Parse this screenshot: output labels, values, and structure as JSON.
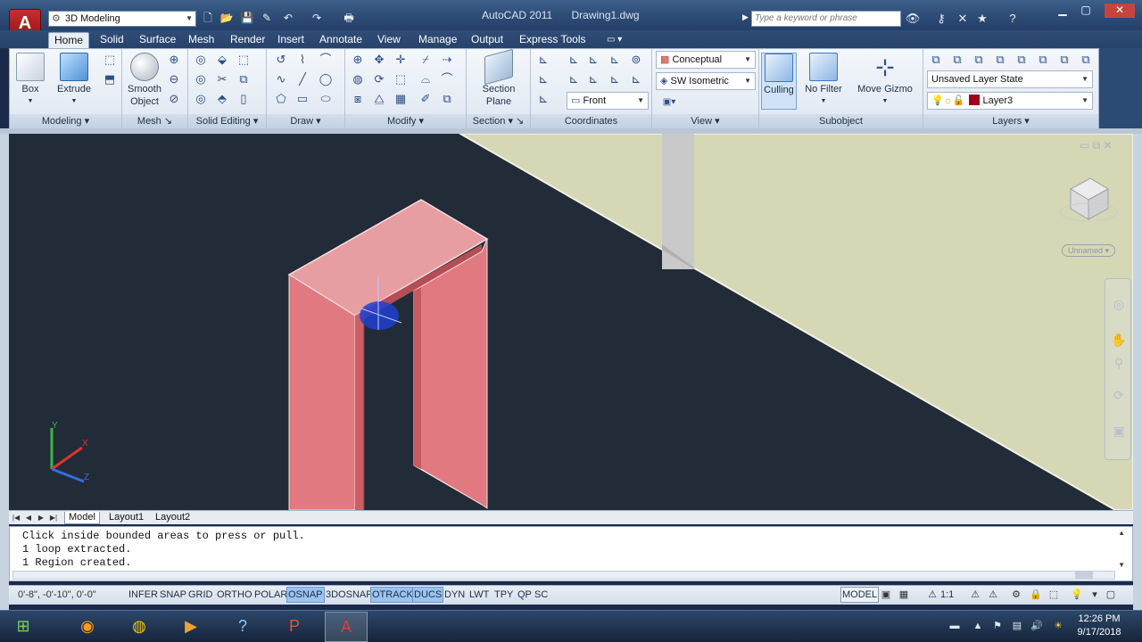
{
  "titlebar": {
    "app_btn": "A",
    "workspace": "3D Modeling",
    "app_title": "AutoCAD 2011",
    "file_title": "Drawing1.dwg",
    "search_placeholder": "Type a keyword or phrase"
  },
  "tabs": [
    "Home",
    "Solid",
    "Surface",
    "Mesh",
    "Render",
    "Insert",
    "Annotate",
    "View",
    "Manage",
    "Output",
    "Express Tools"
  ],
  "ribbon": {
    "modeling": {
      "title": "Modeling",
      "box": "Box",
      "extrude": "Extrude"
    },
    "mesh": {
      "title": "Mesh",
      "smooth1": "Smooth",
      "smooth2": "Object"
    },
    "solid_editing": {
      "title": "Solid Editing"
    },
    "draw": {
      "title": "Draw"
    },
    "modify": {
      "title": "Modify"
    },
    "section": {
      "title": "Section",
      "plane1": "Section",
      "plane2": "Plane"
    },
    "coordinates": {
      "title": "Coordinates",
      "front": "Front"
    },
    "view": {
      "title": "View",
      "style": "Conceptual",
      "iso": "SW Isometric"
    },
    "subobject": {
      "title": "Subobject",
      "culling": "Culling",
      "nofilter": "No Filter",
      "gizmo": "Move Gizmo"
    },
    "layers": {
      "title": "Layers",
      "state": "Unsaved Layer State",
      "layer": "Layer3"
    }
  },
  "viewport": {
    "viewcube_label": "Unnamed",
    "ucs_x": "X",
    "ucs_y": "Y",
    "ucs_z": "Z"
  },
  "layout_tabs": [
    "Model",
    "Layout1",
    "Layout2"
  ],
  "command_lines": [
    "Click inside bounded areas to press or pull.",
    "1 loop extracted.",
    "1 Region created."
  ],
  "status": {
    "coords": "0'-8\",  -0'-10\", 0'-0\"",
    "toggles": [
      "INFER",
      "SNAP",
      "GRID",
      "ORTHO",
      "POLAR",
      "OSNAP",
      "3DOSNAP",
      "OTRACK",
      "DUCS",
      "DYN",
      "LWT",
      "TPY",
      "QP",
      "SC"
    ],
    "model": "MODEL",
    "scale": "1:1"
  },
  "taskbar": {
    "time": "12:26 PM",
    "date": "9/17/2018"
  },
  "colors": {
    "viewport_bg": "#222b38",
    "floor": "#d6d7b4",
    "solid": "#e07a80",
    "osnap_on": "#9cc3ef"
  }
}
